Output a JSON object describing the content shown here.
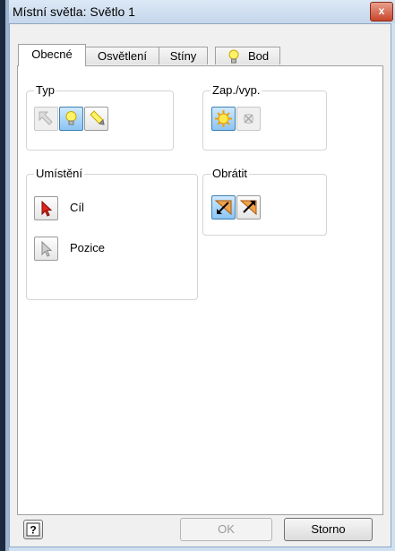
{
  "window": {
    "title": "Místní světla: Světlo 1",
    "close_label": "x"
  },
  "tabs": [
    {
      "label": "Obecné",
      "active": true
    },
    {
      "label": "Osvětlení",
      "active": false
    },
    {
      "label": "Stíny",
      "active": false
    },
    {
      "label": "Bod",
      "active": false,
      "icon": "lightbulb-icon"
    }
  ],
  "groups": {
    "typ": {
      "title": "Typ",
      "buttons": [
        {
          "name": "directional-light",
          "icon": "arrow-light-icon",
          "state": "disabled"
        },
        {
          "name": "point-light",
          "icon": "lightbulb-icon",
          "state": "selected"
        },
        {
          "name": "spot-light",
          "icon": "spotlight-icon",
          "state": "normal"
        }
      ]
    },
    "onoff": {
      "title": "Zap./vyp.",
      "buttons": [
        {
          "name": "light-on",
          "icon": "sun-icon",
          "state": "selected"
        },
        {
          "name": "light-off",
          "icon": "light-off-icon",
          "state": "disabled"
        }
      ]
    },
    "placement": {
      "title": "Umístění",
      "items": [
        {
          "label": "Cíl",
          "icon": "cursor-red-icon"
        },
        {
          "label": "Pozice",
          "icon": "cursor-gray-icon"
        }
      ]
    },
    "flip": {
      "title": "Obrátit",
      "buttons": [
        {
          "name": "flip-direction",
          "icon": "flip-arrow-icon",
          "state": "selected"
        },
        {
          "name": "flip-arrow-alt",
          "icon": "flip-arrow-alt-icon",
          "state": "normal"
        }
      ]
    }
  },
  "footer": {
    "help_label": "?",
    "ok_label": "OK",
    "cancel_label": "Storno"
  },
  "colors": {
    "selected": "#8cc4f3",
    "titlebar": "#c5d7ec",
    "close": "#c8452c"
  }
}
